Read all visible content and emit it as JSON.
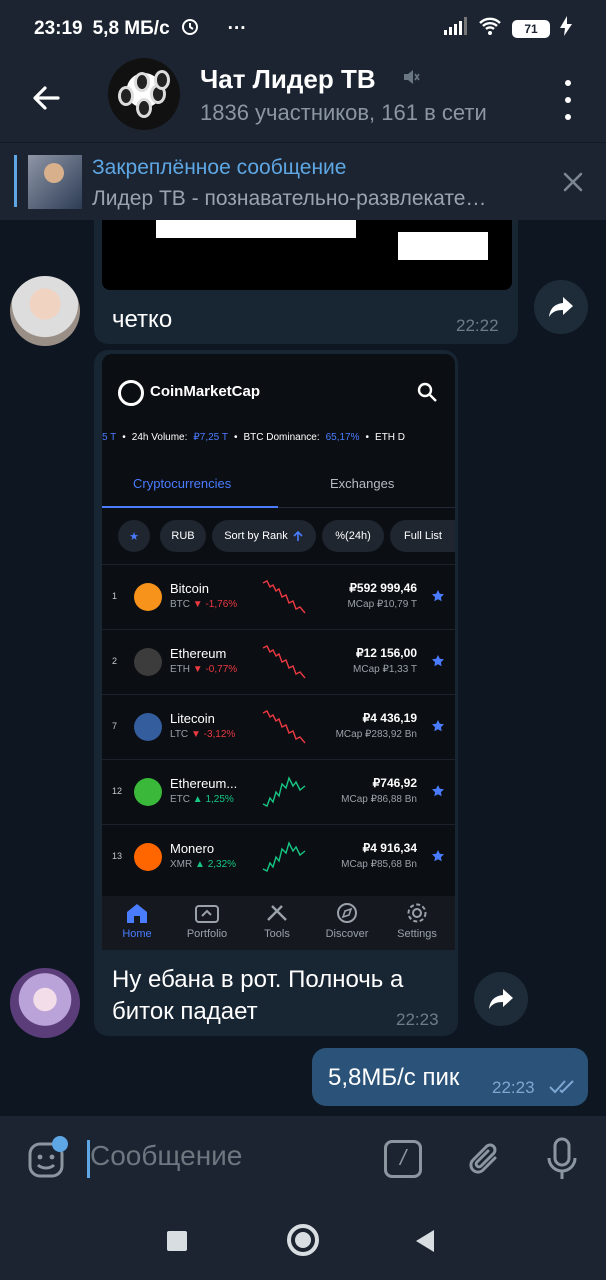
{
  "status_bar": {
    "time": "23:19",
    "speed": "5,8 МБ/с",
    "more": "···",
    "battery": "71"
  },
  "header": {
    "title": "Чат Лидер ТВ",
    "subtitle": "1836 участников, 161 в сети"
  },
  "pinned": {
    "title": "Закреплённое сообщение",
    "text": "Лидер ТВ - познавательно-развлекате…"
  },
  "messages": [
    {
      "text": "четко",
      "time": "22:22"
    },
    {
      "text": "Ну ебана в рот. Полночь а биток падает",
      "time": "22:23"
    },
    {
      "text": "5,8МБ/с пик",
      "time": "22:23",
      "outgoing": true
    }
  ],
  "screenshot": {
    "app_name": "CoinMarketCap",
    "ticker": {
      "lead": "5 T",
      "vol_label": "24h Volume:",
      "vol_value": "₽7,25 T",
      "dom_label": "BTC Dominance:",
      "dom_value": "65,17%",
      "tail": "ETH D"
    },
    "tabs": [
      "Cryptocurrencies",
      "Exchanges"
    ],
    "filters": [
      "★",
      "RUB",
      "Sort by Rank",
      "%(24h)",
      "Full List"
    ],
    "coins": [
      {
        "rank": "1",
        "name": "Bitcoin",
        "symbol": "BTC",
        "change": "▼ -1,76%",
        "price": "₽592 999,46",
        "mcap": "MCap ₽10,79 T",
        "trend": "down",
        "color": "#f7931a"
      },
      {
        "rank": "2",
        "name": "Ethereum",
        "symbol": "ETH",
        "change": "▼ -0,77%",
        "price": "₽12 156,00",
        "mcap": "MCap ₽1,33 T",
        "trend": "down",
        "color": "#3c3c3d"
      },
      {
        "rank": "7",
        "name": "Litecoin",
        "symbol": "LTC",
        "change": "▼ -3,12%",
        "price": "₽4 436,19",
        "mcap": "MCap ₽283,92 Bn",
        "trend": "down",
        "color": "#345d9d"
      },
      {
        "rank": "12",
        "name": "Ethereum...",
        "symbol": "ETC",
        "change": "▲ 1,25%",
        "price": "₽746,92",
        "mcap": "MCap ₽86,88 Bn",
        "trend": "up",
        "color": "#3ab83a"
      },
      {
        "rank": "13",
        "name": "Monero",
        "symbol": "XMR",
        "change": "▲ 2,32%",
        "price": "₽4 916,34",
        "mcap": "MCap ₽85,68 Bn",
        "trend": "up",
        "color": "#ff6600"
      }
    ],
    "nav": [
      "Home",
      "Portfolio",
      "Tools",
      "Discover",
      "Settings"
    ]
  },
  "input": {
    "placeholder": "Сообщение"
  },
  "colors": {
    "background": "#0e1621",
    "panel": "#1b2430",
    "accent": "#5ea7e4",
    "bubble_in": "#182533",
    "bubble_out": "#2b5278"
  }
}
